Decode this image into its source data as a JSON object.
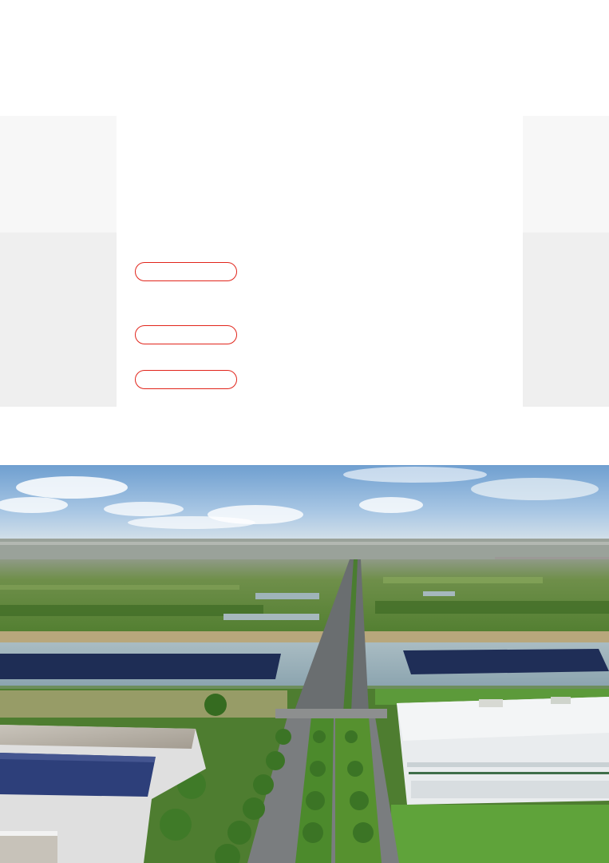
{
  "nav_buttons": [
    {
      "label": ""
    },
    {
      "label": ""
    },
    {
      "label": ""
    }
  ],
  "colors": {
    "accent": "#e1251b",
    "panel_light": "#f7f7f7",
    "panel_mid": "#efefef",
    "background": "#ffffff"
  },
  "hero_image": {
    "subject": "aerial-photo"
  }
}
